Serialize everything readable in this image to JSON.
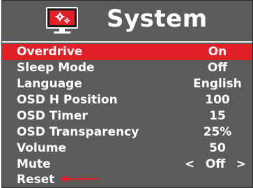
{
  "header": {
    "title": "System",
    "icon": "monitor-gear-icon",
    "icon_color": "#e01f26"
  },
  "colors": {
    "background": "#5b5b5b",
    "highlight": "#e01f26",
    "text": "#ffffff",
    "annotation_arrow": "#e01f26"
  },
  "menu": {
    "items": [
      {
        "label": "Overdrive",
        "value": "On",
        "selected": true
      },
      {
        "label": "Sleep Mode",
        "value": "Off"
      },
      {
        "label": "Language",
        "value": "English"
      },
      {
        "label": "OSD H Position",
        "value": "100"
      },
      {
        "label": "OSD Timer",
        "value": "15"
      },
      {
        "label": "OSD Transparency",
        "value": "25%"
      },
      {
        "label": "Volume",
        "value": "50"
      }
    ],
    "mute": {
      "label": "Mute",
      "value": "Off",
      "prev_glyph": "<",
      "next_glyph": ">"
    },
    "reset": {
      "label": "Reset"
    }
  }
}
